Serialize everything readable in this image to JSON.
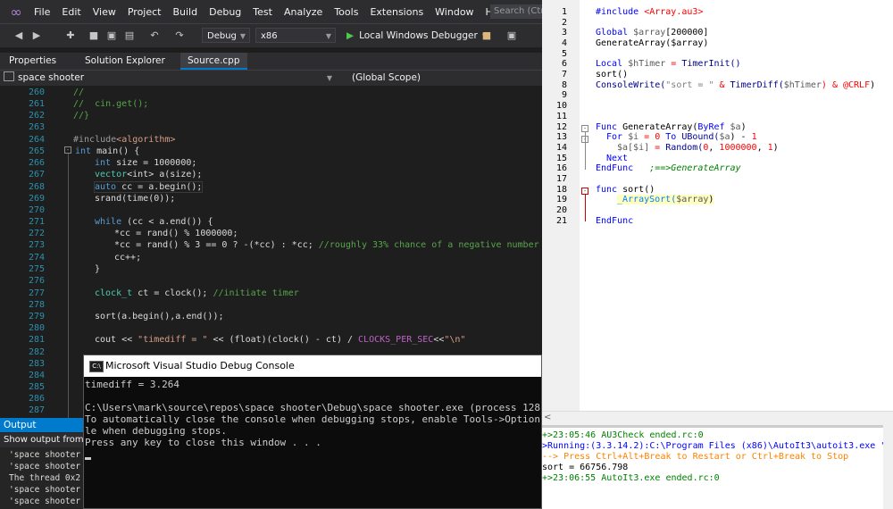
{
  "vs": {
    "menu": [
      "File",
      "Edit",
      "View",
      "Project",
      "Build",
      "Debug",
      "Test",
      "Analyze",
      "Tools",
      "Extensions",
      "Window",
      "Help"
    ],
    "search_placeholder": "Search (Ctrl",
    "toolbar": {
      "config": "Debug",
      "platform": "x86",
      "run_label": "Local Windows Debugger"
    },
    "tabs": {
      "properties": "Properties",
      "solution_explorer": "Solution Explorer",
      "source": "Source.cpp"
    },
    "nav": {
      "project": "space shooter",
      "scope": "(Global Scope)"
    },
    "line_numbers": [
      "260",
      "261",
      "262",
      "263",
      "264",
      "265",
      "266",
      "267",
      "268",
      "269",
      "270",
      "271",
      "272",
      "273",
      "274",
      "275",
      "276",
      "277",
      "278",
      "279",
      "280",
      "281",
      "282",
      "283",
      "284",
      "285",
      "286",
      "287"
    ],
    "code": {
      "l260": "//",
      "l261": "//  cin.get();",
      "l262": "//}",
      "l264_pp": "#include",
      "l264_h": "<algorithm>",
      "l265_kw": "int",
      "l265_rest": " main() {",
      "l266_kw": "int",
      "l266_rest": " size = 1000000;",
      "l267_ty": "vector",
      "l267_rest": "<int> a(size);",
      "l268_kw": "auto",
      "l268_rest": " cc = a.begin();",
      "l269": "srand(time(0));",
      "l271_kw": "while",
      "l271_rest": " (cc < a.end()) {",
      "l272": "*cc = rand() % 1000000;",
      "l273_code": "*cc = rand() % 3 == 0 ? -(*cc) : *cc; ",
      "l273_cm": "//roughly 33% chance of a negative number",
      "l274": "cc++;",
      "l275": "}",
      "l277_ty": "clock_t",
      "l277_rest": " ct = clock(); ",
      "l277_cm": "//initiate timer",
      "l279": "sort(a.begin(),a.end());",
      "l281_a": "cout << ",
      "l281_s": "\"timediff = \"",
      "l281_b": " << (float)(clock() - ct) / ",
      "l281_m": "CLOCKS_PER_SEC",
      "l281_c": "<<",
      "l281_s2": "\"\\n\""
    },
    "output": {
      "title": "Output",
      "show_from": "Show output from:",
      "lines": [
        "'space shooter",
        "'space shooter",
        "The thread 0x2",
        "'space shooter",
        "'space shooter"
      ]
    },
    "console": {
      "icon_text": "C:\\",
      "title": "Microsoft Visual Studio Debug Console",
      "lines": [
        "timediff = 3.264",
        "",
        "C:\\Users\\mark\\source\\repos\\space shooter\\Debug\\space shooter.exe (process 128",
        "To automatically close the console when debugging stops, enable Tools->Option",
        "le when debugging stops.",
        "Press any key to close this window . . ."
      ]
    }
  },
  "scite": {
    "line_numbers": [
      "1",
      "2",
      "3",
      "4",
      "5",
      "6",
      "7",
      "8",
      "9",
      "10",
      "11",
      "12",
      "13",
      "14",
      "15",
      "16",
      "17",
      "18",
      "19",
      "20",
      "21"
    ],
    "code": {
      "l1_kw": "#include",
      "l1_inc": " <Array.au3>",
      "l3_kw": "Global",
      "l3_var": " $array",
      "l3_rest": "[200000]",
      "l4": "GenerateArray($array)",
      "l6_kw": "Local",
      "l6_var": " $hTimer",
      "l6_op": " = ",
      "l6_fn": "TimerInit()",
      "l7": "sort()",
      "l8_fn": "ConsoleWrite(",
      "l8_str": "\"sort = \"",
      "l8_op": " & ",
      "l8_fn2": "TimerDiff(",
      "l8_var": "$hTimer",
      "l8_op2": ") & ",
      "l8_macro": "@CRLF",
      "l8_end": ")",
      "l12_kw": "Func",
      "l12_rest": " GenerateArray(",
      "l12_kw2": "ByRef",
      "l12_var": " $a",
      "l12_end": ")",
      "l13_kw": "For",
      "l13_var": " $i",
      "l13_op": " = ",
      "l13_num": "0",
      "l13_kw2": " To ",
      "l13_fn": "UBound(",
      "l13_var2": "$a",
      "l13_rest": ") - ",
      "l13_num2": "1",
      "l14_var": "$a[$i]",
      "l14_op": " = ",
      "l14_fn": "Random(",
      "l14_num": "0",
      "l14_sep": ", ",
      "l14_num2": "1000000",
      "l14_sep2": ", ",
      "l14_num3": "1",
      "l14_end": ")",
      "l15_kw": "Next",
      "l16_kw": "EndFunc",
      "l16_cm": "   ;==>GenerateArray",
      "l18_kw": "func",
      "l18_rest": " sort()",
      "l19_udf": "_ArraySort(",
      "l19_var": "$array",
      "l19_end": ")",
      "l21_kw": "EndFunc"
    },
    "hscroll_arrow": "<",
    "output": [
      {
        "text": "+>23:05:46 AU3Check ended.rc:0",
        "color": "#008000"
      },
      {
        "text": ">Running:(3.3.14.2):C:\\Program Files (x86)\\AutoIt3\\autoit3.exe \"",
        "color": "#0000ff"
      },
      {
        "text": "--> Press Ctrl+Alt+Break to Restart or Ctrl+Break to Stop",
        "color": "#ff8000"
      },
      {
        "text": "sort = 66756.798",
        "color": "#000000"
      },
      {
        "text": "+>23:06:55 AutoIt3.exe ended.rc:0",
        "color": "#008000"
      }
    ]
  }
}
